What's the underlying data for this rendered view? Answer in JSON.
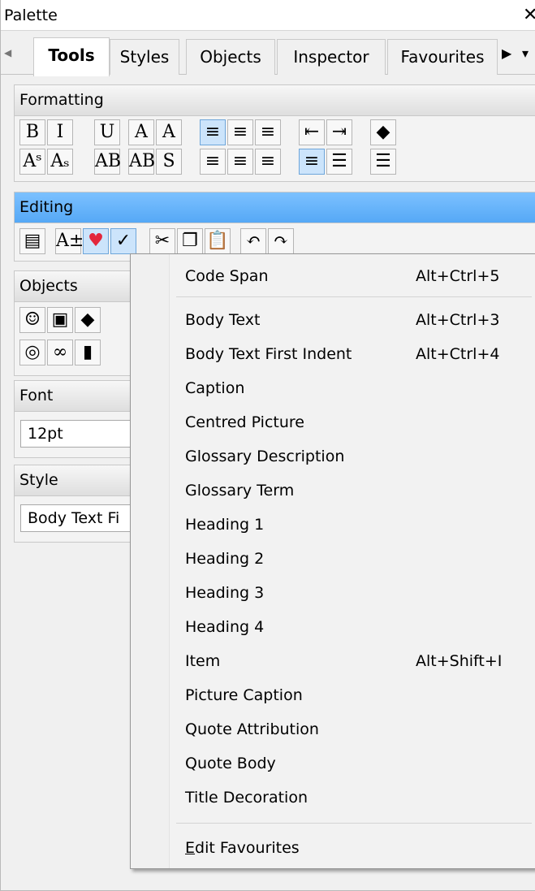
{
  "window": {
    "title": "Palette",
    "close_glyph": "✕"
  },
  "tabs": {
    "items": [
      "Tools",
      "Styles",
      "Objects",
      "Inspector",
      "Favourites"
    ],
    "active": "Tools",
    "scroll_left_glyph": "◀",
    "scroll_right_glyph": "▶",
    "overflow_glyph": "▾"
  },
  "sections": {
    "formatting": "Formatting",
    "editing": "Editing",
    "objects": "Objects",
    "font": "Font",
    "style": "Style"
  },
  "formatting_buttons_row1": [
    {
      "icon": "bold-icon",
      "glyph": "B"
    },
    {
      "icon": "italic-icon",
      "glyph": "I"
    },
    {
      "icon": "underline-icon",
      "glyph": "U"
    },
    {
      "icon": "text-color-icon",
      "glyph": "A"
    },
    {
      "icon": "highlight-color-icon",
      "glyph": "A"
    },
    {
      "icon": "justify-full-icon",
      "glyph": "≡"
    },
    {
      "icon": "justify-center-icon",
      "glyph": "≡"
    },
    {
      "icon": "justify-right-icon",
      "glyph": "≡"
    },
    {
      "icon": "outdent-icon",
      "glyph": "⇤"
    },
    {
      "icon": "indent-icon",
      "glyph": "⇥"
    },
    {
      "icon": "eraser-icon",
      "glyph": "◆"
    }
  ],
  "formatting_buttons_row2": [
    {
      "icon": "superscript-icon",
      "glyph": "Aˢ"
    },
    {
      "icon": "subscript-icon",
      "glyph": "Aₛ"
    },
    {
      "icon": "small-caps-icon",
      "glyph": "AB"
    },
    {
      "icon": "all-caps-icon",
      "glyph": "AB"
    },
    {
      "icon": "strikethrough-icon",
      "glyph": "S"
    },
    {
      "icon": "align-left-icon",
      "glyph": "≡"
    },
    {
      "icon": "align-center-icon",
      "glyph": "≡"
    },
    {
      "icon": "align-right-icon",
      "glyph": "≡"
    },
    {
      "icon": "align-justify-icon",
      "glyph": "≡"
    },
    {
      "icon": "bullet-list-icon",
      "glyph": "☰"
    },
    {
      "icon": "numbered-list-icon",
      "glyph": "☰"
    }
  ],
  "editing_buttons": [
    {
      "icon": "properties-icon",
      "glyph": "▤"
    },
    {
      "icon": "text-size-icon",
      "glyph": "A±"
    },
    {
      "icon": "favourites-heart-icon",
      "glyph": "♥"
    },
    {
      "icon": "spellcheck-icon",
      "glyph": "✓"
    },
    {
      "icon": "cut-icon",
      "glyph": "✂"
    },
    {
      "icon": "copy-icon",
      "glyph": "❐"
    },
    {
      "icon": "paste-icon",
      "glyph": "📋"
    },
    {
      "icon": "undo-icon",
      "glyph": "↶"
    },
    {
      "icon": "redo-icon",
      "glyph": "↷"
    }
  ],
  "objects_buttons": [
    {
      "icon": "emoji-icon",
      "glyph": "☺"
    },
    {
      "icon": "picture-icon",
      "glyph": "▣"
    },
    {
      "icon": "shapes-icon",
      "glyph": "◆"
    },
    {
      "icon": "hyperlink-icon",
      "glyph": "◎"
    },
    {
      "icon": "link-icon",
      "glyph": "∞"
    },
    {
      "icon": "bookmark-icon",
      "glyph": "▮"
    }
  ],
  "font": {
    "size_value": "12pt",
    "dropdown_glyph": "⌄"
  },
  "style": {
    "value": "Body Text Fi"
  },
  "menu": {
    "items": [
      {
        "label": "Code Span",
        "shortcut": "Alt+Ctrl+5"
      },
      {
        "label": "Body Text",
        "shortcut": "Alt+Ctrl+3"
      },
      {
        "label": "Body Text First Indent",
        "shortcut": "Alt+Ctrl+4"
      },
      {
        "label": "Caption",
        "shortcut": ""
      },
      {
        "label": "Centred Picture",
        "shortcut": ""
      },
      {
        "label": "Glossary Description",
        "shortcut": ""
      },
      {
        "label": "Glossary Term",
        "shortcut": ""
      },
      {
        "label": "Heading 1",
        "shortcut": ""
      },
      {
        "label": "Heading 2",
        "shortcut": ""
      },
      {
        "label": "Heading 3",
        "shortcut": ""
      },
      {
        "label": "Heading 4",
        "shortcut": ""
      },
      {
        "label": "Item",
        "shortcut": "Alt+Shift+I"
      },
      {
        "label": "Picture Caption",
        "shortcut": ""
      },
      {
        "label": "Quote Attribution",
        "shortcut": ""
      },
      {
        "label": "Quote Body",
        "shortcut": ""
      },
      {
        "label": "Title Decoration",
        "shortcut": ""
      },
      {
        "label": "Edit Favourites",
        "shortcut": ""
      }
    ]
  },
  "colors": {
    "editing_header": "#55a8f6",
    "selected_button": "#cce4fb",
    "heart": "#e3263b"
  }
}
